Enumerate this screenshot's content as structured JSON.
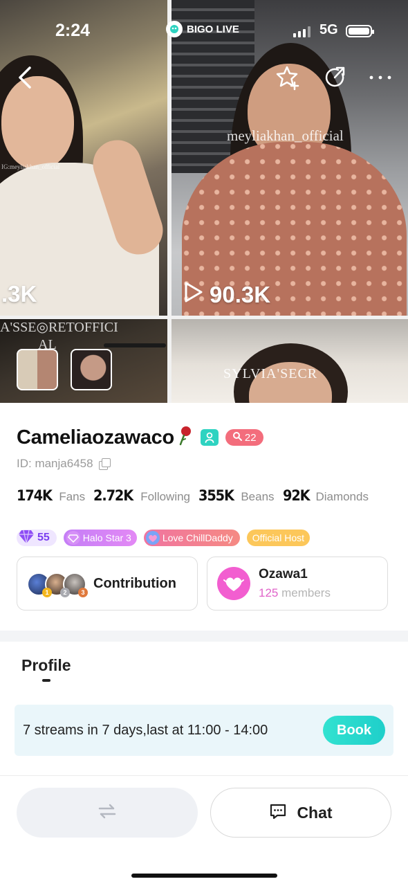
{
  "status_bar": {
    "time": "2:24",
    "brand": "BIGO LIVE",
    "network": "5G"
  },
  "hero": {
    "tiles": [
      {
        "views": ".3K",
        "watermark": "IG:meyliakhan_official"
      },
      {
        "views": "90.3K",
        "watermark": "meyliakhan_official"
      },
      {
        "watermark_line1": "A'SSE◎RETOFFICI",
        "watermark_line2": "AL"
      },
      {
        "watermark": "SYLVIA'SECR"
      }
    ]
  },
  "profile": {
    "name": "Cameliaozawaco",
    "level": "22",
    "id_label": "ID: manja6458",
    "stats": [
      {
        "value": "174K",
        "label": "Fans"
      },
      {
        "value": "2.72K",
        "label": "Following"
      },
      {
        "value": "355K",
        "label": "Beans"
      },
      {
        "value": "92K",
        "label": "Diamonds"
      }
    ],
    "badges": {
      "diamond_level": "55",
      "halo": "Halo Star 3",
      "love": "Love ChillDaddy",
      "host": "Official Host"
    }
  },
  "contribution": {
    "label": "Contribution",
    "ranks": [
      "1",
      "2",
      "3"
    ]
  },
  "family": {
    "name": "Ozawa1",
    "member_count": "125",
    "member_suffix": " members"
  },
  "tabs": {
    "profile": "Profile"
  },
  "schedule": {
    "text": "7 streams in 7 days,last at 11:00 - 14:00",
    "book_label": "Book"
  },
  "actions": {
    "chat_label": "Chat"
  },
  "colors": {
    "accent_teal": "#2ed3c1",
    "level_badge": "#f36d7c",
    "family_pink": "#f25ed0",
    "host_gold": "#fcc75a",
    "diamond_purple": "#7b3ff0"
  },
  "icons": [
    "back-icon",
    "favorite-star-icon",
    "share-icon",
    "more-icon",
    "play-icon",
    "gender-icon",
    "search-level-icon",
    "copy-icon",
    "diamond-icon",
    "halo-icon",
    "heart-icon",
    "family-heart-icon",
    "swap-icon",
    "chat-icon"
  ]
}
